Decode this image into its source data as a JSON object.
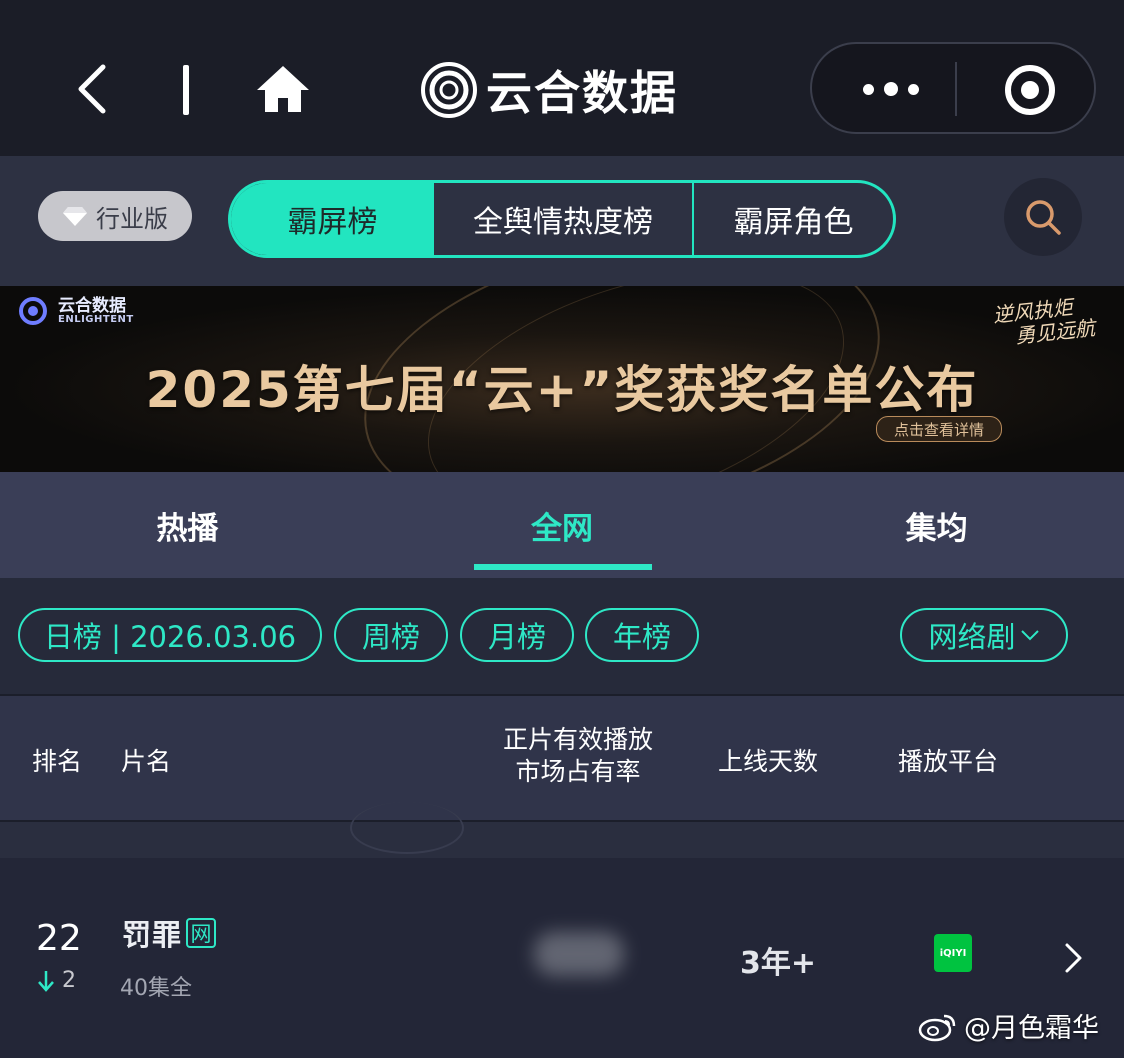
{
  "topbar": {
    "brand_title": "云合数据",
    "back_icon": "chevron-left-icon",
    "home_icon": "home-icon",
    "more_icon": "more-dots-icon",
    "close_icon": "target-circle-icon"
  },
  "switcher": {
    "edition_label": "行业版",
    "segments": [
      "霸屏榜",
      "全舆情热度榜",
      "霸屏角色"
    ],
    "active_segment": "霸屏榜",
    "search_icon": "search-icon"
  },
  "banner": {
    "logo_cn": "云合数据",
    "logo_en": "ENLIGHTENT",
    "headline": "2025第七届“云+”奖获奖名单公布",
    "detail_button": "点击查看详情",
    "slogan_line1": "逆风执炬",
    "slogan_line2": "勇见远航"
  },
  "tabs": {
    "items": [
      "热播",
      "全网",
      "集均"
    ],
    "active": "全网"
  },
  "filters": {
    "day": "日榜 | 2026.03.06",
    "week": "周榜",
    "month": "月榜",
    "year": "年榜",
    "type": "网络剧"
  },
  "table": {
    "headers": {
      "rank": "排名",
      "name": "片名",
      "share_line1": "正片有效播放",
      "share_line2": "市场占有率",
      "days": "上线天数",
      "platform": "播放平台"
    },
    "rows": [
      {
        "rank": "22",
        "change": "2",
        "change_direction": "down",
        "title": "罚罪",
        "badge": "网",
        "episodes": "40集全",
        "days": "3年+",
        "platform": "iQIYI"
      }
    ]
  },
  "watermark": {
    "text": "@月色霜华"
  },
  "colors": {
    "accent": "#2ee8c6",
    "topbar_bg": "#1b1d27",
    "tab_bg": "#3a3e57",
    "page_bg": "#262a3a",
    "iqiyi_green": "#00c340"
  }
}
